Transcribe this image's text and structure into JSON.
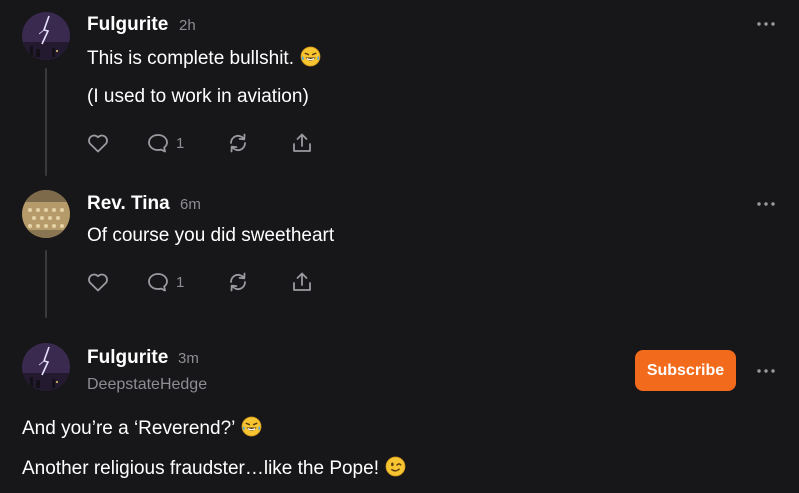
{
  "comments": [
    {
      "author": "Fulgurite",
      "time": "2h",
      "lines": [
        "This is complete bullshit.",
        "(I used to work in aviation)"
      ],
      "emojis": [
        "face-with-tears-of-joy"
      ],
      "reply_count": "1",
      "icons": [
        "heart-icon",
        "comment-icon",
        "restack-icon",
        "share-icon",
        "more-icon"
      ]
    },
    {
      "author": "Rev. Tina",
      "time": "6m",
      "lines": [
        "Of course you did sweetheart"
      ],
      "reply_count": "1",
      "icons": [
        "heart-icon",
        "comment-icon",
        "restack-icon",
        "share-icon",
        "more-icon"
      ]
    },
    {
      "author": "Fulgurite",
      "time": "3m",
      "handle": "DeepstateHedge",
      "subscribe_label": "Subscribe",
      "lines": [
        "And you’re a ‘Reverend?’",
        "Another religious fraudster…like the Pope!"
      ],
      "emojis": [
        "face-with-tears-of-joy",
        "winking-face"
      ],
      "icons": [
        "more-icon"
      ]
    }
  ],
  "colors": {
    "background": "#171719",
    "text": "#ffffff",
    "muted": "#8d8d93",
    "accent": "#f26a1b",
    "thread_line": "#3a3a3d"
  }
}
